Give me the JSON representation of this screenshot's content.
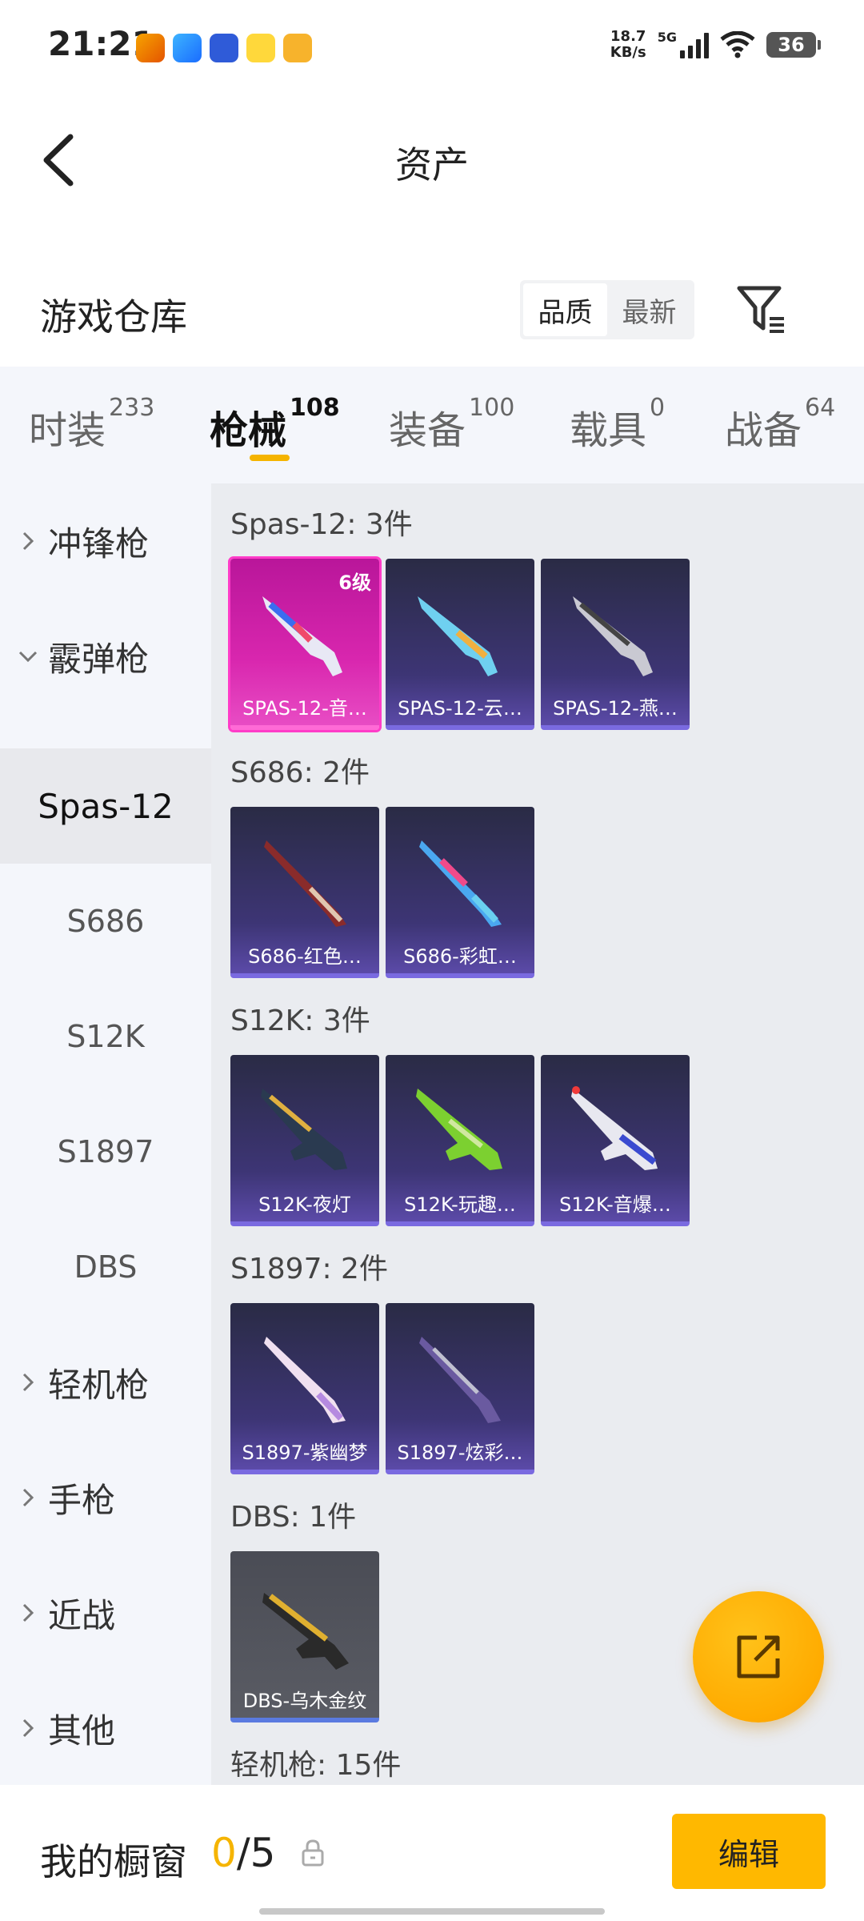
{
  "status_bar": {
    "time": "21:21",
    "net_speed_value": "18.7",
    "net_speed_unit": "KB/s",
    "network": "5G",
    "battery": "36"
  },
  "header": {
    "title": "资产",
    "back_icon": "back-arrow-icon"
  },
  "section": {
    "title": "游戏仓库",
    "sort_options": [
      "品质",
      "最新"
    ],
    "sort_selected": "品质",
    "filter_icon": "filter-icon"
  },
  "tabs": [
    {
      "label": "时装",
      "count": "233"
    },
    {
      "label": "枪械",
      "count": "108",
      "active": true
    },
    {
      "label": "装备",
      "count": "100"
    },
    {
      "label": "载具",
      "count": "0"
    },
    {
      "label": "战备",
      "count": "64"
    }
  ],
  "sidebar": {
    "items": [
      {
        "label": "冲锋枪",
        "type": "category",
        "expanded": false
      },
      {
        "label": "霰弹枪",
        "type": "category",
        "expanded": true
      },
      {
        "label": "Spas-12",
        "type": "sub",
        "active": true
      },
      {
        "label": "S686",
        "type": "sub"
      },
      {
        "label": "S12K",
        "type": "sub"
      },
      {
        "label": "S1897",
        "type": "sub"
      },
      {
        "label": "DBS",
        "type": "sub"
      },
      {
        "label": "轻机枪",
        "type": "category",
        "expanded": false
      },
      {
        "label": "手枪",
        "type": "category",
        "expanded": false
      },
      {
        "label": "近战",
        "type": "category",
        "expanded": false
      },
      {
        "label": "其他",
        "type": "category",
        "expanded": false
      }
    ]
  },
  "groups": [
    {
      "label": "Spas-12: 3件",
      "items": [
        {
          "name": "SPAS-12-音…",
          "level": "6级",
          "rarity": "pink"
        },
        {
          "name": "SPAS-12-云…",
          "rarity": "purple"
        },
        {
          "name": "SPAS-12-燕…",
          "rarity": "purple"
        }
      ]
    },
    {
      "label": "S686: 2件",
      "items": [
        {
          "name": "S686-红色…",
          "rarity": "purple"
        },
        {
          "name": "S686-彩虹…",
          "rarity": "purple"
        }
      ]
    },
    {
      "label": "S12K: 3件",
      "items": [
        {
          "name": "S12K-夜灯",
          "rarity": "purple"
        },
        {
          "name": "S12K-玩趣…",
          "rarity": "purple"
        },
        {
          "name": "S12K-音爆…",
          "rarity": "purple"
        }
      ]
    },
    {
      "label": "S1897: 2件",
      "items": [
        {
          "name": "S1897-紫幽梦",
          "rarity": "purple"
        },
        {
          "name": "S1897-炫彩…",
          "rarity": "purple"
        }
      ]
    },
    {
      "label": "DBS: 1件",
      "items": [
        {
          "name": "DBS-乌木金纹",
          "rarity": "gray"
        }
      ]
    },
    {
      "label": "轻机枪: 15件",
      "items": []
    }
  ],
  "fab": {
    "icon": "share-external-icon"
  },
  "bottom_bar": {
    "label": "我的橱窗",
    "current": "0",
    "separator": "/",
    "total": "5",
    "edit_label": "编辑"
  },
  "colors": {
    "accent": "#ffb800",
    "tab_indicator": "#f5b400",
    "purple_card": "#3d3575",
    "pink_card": "#d826ae"
  }
}
